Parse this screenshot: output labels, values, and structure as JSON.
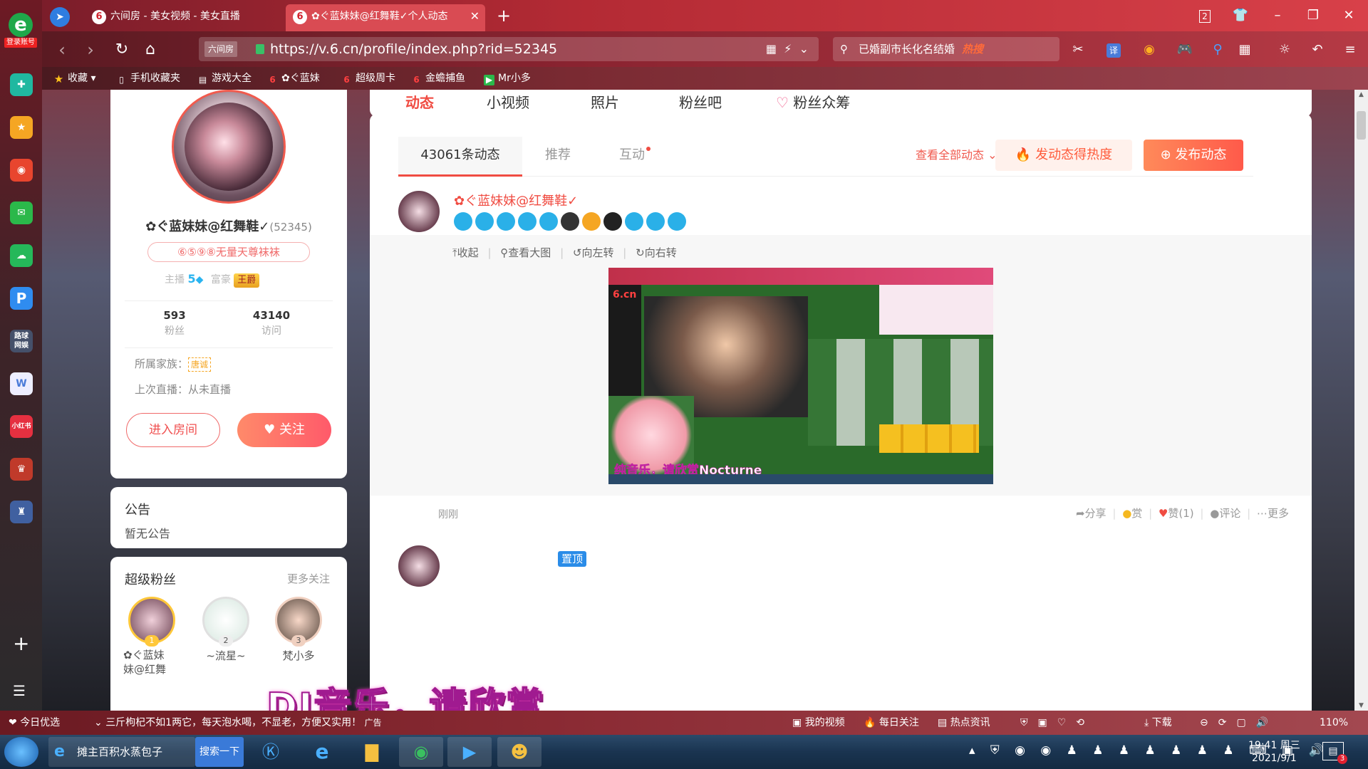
{
  "sidebar": {
    "login_label": "登录账号",
    "apps": [
      {
        "icon": "plus-cross-icon",
        "color": "#20b8a0"
      },
      {
        "icon": "star-icon",
        "color": "#f5a623"
      },
      {
        "icon": "weibo-icon",
        "color": "#e8452e"
      },
      {
        "icon": "mail-icon",
        "color": "#2bb84a"
      },
      {
        "icon": "cloud-icon",
        "color": "#25b85a"
      },
      {
        "icon": "p-icon",
        "color": "#2f8cf0"
      },
      {
        "icon": "game-icon",
        "color": "#556",
        "label": "路球\n网娱"
      },
      {
        "icon": "doc-icon",
        "color": "#4a7bd8"
      },
      {
        "icon": "red-icon",
        "color": "#e53040",
        "label": "小红书"
      },
      {
        "icon": "game2-icon",
        "color": "#c03a2a"
      },
      {
        "icon": "game3-icon",
        "color": "#4060a0"
      }
    ]
  },
  "browser": {
    "tabs": [
      {
        "title": "六间房 - 美女视频 - 美女直播",
        "active": false
      },
      {
        "title": "✿ぐ蓝妹妹@红舞鞋✓个人动态",
        "active": true
      }
    ],
    "new_tab": "+",
    "window_badge": "2",
    "url_site": "六间房",
    "url": "https://v.6.cn/profile/index.php?rid=52345",
    "search_text": "已婚副市长化名结婚",
    "search_hot": "热搜",
    "translate_label": "译",
    "bookmarks": [
      {
        "label": "收藏",
        "icon": "star"
      },
      {
        "label": "手机收藏夹",
        "icon": "phone"
      },
      {
        "label": "游戏大全",
        "icon": "doc"
      },
      {
        "label": "✿ぐ蓝妹",
        "icon": "6"
      },
      {
        "label": "超级周卡",
        "icon": "6"
      },
      {
        "label": "金蟾捕鱼",
        "icon": "6"
      },
      {
        "label": "Mr小多",
        "icon": "m"
      }
    ]
  },
  "top_nav": {
    "items": [
      "动态",
      "小视频",
      "照片",
      "粉丝吧",
      "粉丝众筹"
    ],
    "active": "动态"
  },
  "profile": {
    "name": "✿ぐ蓝妹妹@红舞鞋✓",
    "rid": "(52345)",
    "badge": "⑥⑤⑨⑧无量天尊袜袜",
    "anchor_label": "主播",
    "anchor_level": "5",
    "rich_label": "富豪",
    "rich_title": "王爵",
    "fans_count": "593",
    "fans_label": "粉丝",
    "visits_count": "43140",
    "visits_label": "访问",
    "family_label": "所属家族：",
    "family_value": "唐诚",
    "last_live": "上次直播：从未直播",
    "enter_room": "进入房间",
    "follow": "关注"
  },
  "notice": {
    "title": "公告",
    "content": "暂无公告"
  },
  "super_fans": {
    "title": "超级粉丝",
    "more": "更多关注",
    "items": [
      {
        "rank": "1",
        "name": "✿ぐ蓝妹\n妹@红舞"
      },
      {
        "rank": "2",
        "name": "~流星~"
      },
      {
        "rank": "3",
        "name": "梵小多"
      }
    ]
  },
  "feed": {
    "tabs": [
      "43061条动态",
      "推荐",
      "互动"
    ],
    "view_all": "查看全部动态",
    "hot_button": "发动态得热度",
    "post_button": "发布动态",
    "post": {
      "author": "✿ぐ蓝妹妹@红舞鞋✓",
      "actions": [
        "收起",
        "查看大图",
        "向左转",
        "向右转"
      ],
      "time": "刚刚",
      "share": "分享",
      "reward": "赏",
      "like": "赞(1)",
      "comment": "评论",
      "more": "更多"
    },
    "pinned_label": "置顶",
    "screenshot_caption": "纯音乐，请欣赏Nocturne"
  },
  "overlay_caption": "DJ音乐，请欣赏",
  "statusbar": {
    "today": "今日优选",
    "news": "三斤枸杞不如1两它，每天泡水喝，不显老，方便又实用！",
    "ad": "广告",
    "my_video": "我的视频",
    "daily": "每日关注",
    "hot_news": "热点资讯",
    "download": "下载",
    "zoom": "110%"
  },
  "taskbar": {
    "ie_task": "摊主百积水蒸包子",
    "search_btn": "搜索一下",
    "time": "19:41 周三",
    "date": "2021/9/1",
    "notification_count": "3"
  },
  "colors": {
    "accent": "#ff5a4e",
    "orange": "#ff6b3a",
    "brand_red": "#e53040"
  }
}
